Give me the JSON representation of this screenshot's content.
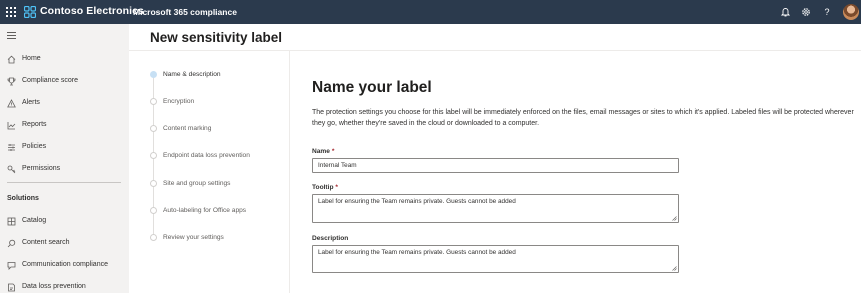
{
  "topbar": {
    "brand": "Contoso Electronics",
    "app_name": "Microsoft 365 compliance",
    "icons": [
      "waffle-icon",
      "brand-logo-icon",
      "bell-icon",
      "gear-icon",
      "help-icon",
      "avatar"
    ]
  },
  "colors": {
    "topbar_bg": "#2b3a4d",
    "nav_bg": "#f3f2f1",
    "brand_logo": "#4fc3f7",
    "active_step": "#c7e0f4",
    "required": "#a4262c"
  },
  "nav": {
    "items": [
      {
        "label": "Home",
        "icon": "home-icon"
      },
      {
        "label": "Compliance score",
        "icon": "trophy-icon"
      },
      {
        "label": "Alerts",
        "icon": "warning-icon"
      },
      {
        "label": "Reports",
        "icon": "chart-icon"
      },
      {
        "label": "Policies",
        "icon": "policies-icon"
      },
      {
        "label": "Permissions",
        "icon": "key-icon"
      }
    ],
    "section_title": "Solutions",
    "solutions": [
      {
        "label": "Catalog",
        "icon": "catalog-icon"
      },
      {
        "label": "Content search",
        "icon": "search-icon"
      },
      {
        "label": "Communication compliance",
        "icon": "chat-icon"
      },
      {
        "label": "Data loss prevention",
        "icon": "dlp-icon"
      }
    ]
  },
  "page": {
    "title": "New sensitivity label"
  },
  "steps": [
    {
      "label": "Name & description",
      "active": true
    },
    {
      "label": "Encryption",
      "active": false
    },
    {
      "label": "Content marking",
      "active": false
    },
    {
      "label": "Endpoint data loss prevention",
      "active": false
    },
    {
      "label": "Site and group settings",
      "active": false
    },
    {
      "label": "Auto-labeling for Office apps",
      "active": false
    },
    {
      "label": "Review your settings",
      "active": false
    }
  ],
  "form": {
    "heading": "Name your label",
    "description": "The protection settings you choose for this label will be immediately enforced on the files, email messages or sites to which it's applied. Labeled files will be protected wherever they go, whether they're saved in the cloud or downloaded to a computer.",
    "name_label": "Name",
    "name_value": "Internal Team",
    "tooltip_label": "Tooltip",
    "tooltip_value": "Label for ensuring the Team remains private. Guests cannot be added",
    "description_label": "Description",
    "description_value": "Label for ensuring the Team remains private. Guests cannot be added",
    "required_mark": "*"
  }
}
